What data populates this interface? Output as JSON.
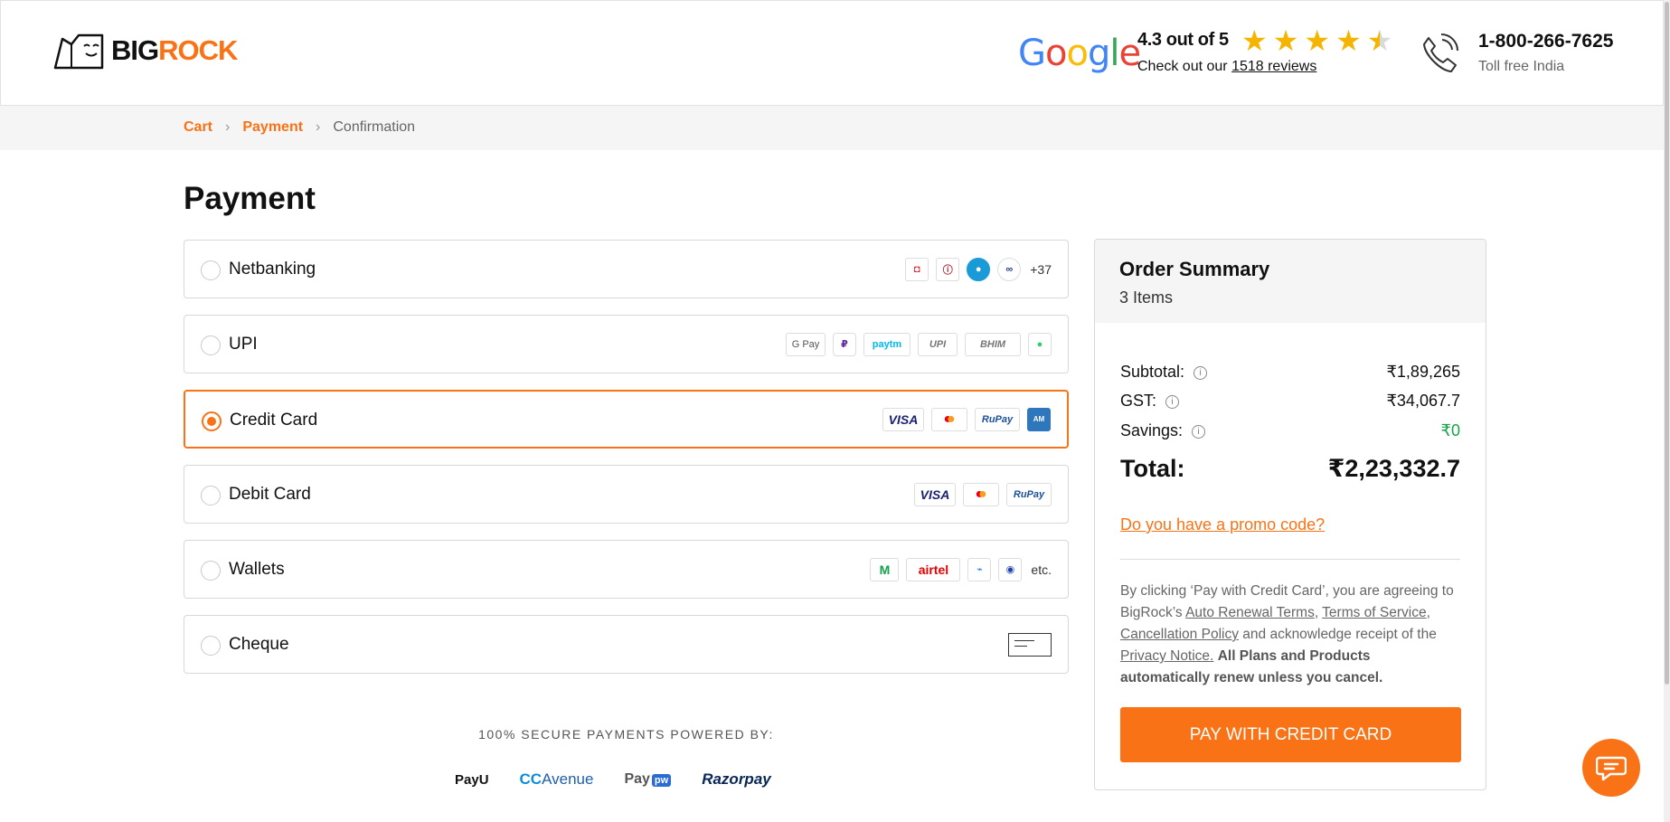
{
  "header": {
    "logo_big": "BIG",
    "logo_rock": "ROCK",
    "google": [
      "G",
      "o",
      "o",
      "g",
      "l",
      "e"
    ],
    "rating_text": "4.3 out of 5",
    "rating_value": 4.3,
    "reviews_prefix": "Check out our ",
    "reviews_link": "1518 reviews",
    "phone": "1-800-266-7625",
    "phone_sub": "Toll free India"
  },
  "breadcrumb": {
    "cart": "Cart",
    "payment": "Payment",
    "confirmation": "Confirmation"
  },
  "page_title": "Payment",
  "options": {
    "netbanking": {
      "label": "Netbanking",
      "more": "+37"
    },
    "upi": {
      "label": "UPI",
      "gpay": "G Pay",
      "paytm": "paytm",
      "upi": "UPI",
      "bhim": "BHIM"
    },
    "credit": {
      "label": "Credit Card",
      "visa": "VISA",
      "rupay": "RuPay"
    },
    "debit": {
      "label": "Debit Card",
      "visa": "VISA",
      "rupay": "RuPay"
    },
    "wallets": {
      "label": "Wallets",
      "airtel": "airtel",
      "etc": "etc."
    },
    "cheque": {
      "label": "Cheque"
    }
  },
  "secure_text": "100% SECURE PAYMENTS POWERED BY:",
  "gateways": {
    "payu": "PayU",
    "cca_cc": "CC",
    "cca_rest": "Avenue",
    "paypw": "Pay",
    "paypw_badge": "pw",
    "razorpay": "Razorpay"
  },
  "summary": {
    "title": "Order Summary",
    "items": "3 Items",
    "subtotal_label": "Subtotal:",
    "subtotal": "₹1,89,265",
    "gst_label": "GST:",
    "gst": "₹34,067.7",
    "savings_label": "Savings:",
    "savings": "₹0",
    "total_label": "Total:",
    "total": "₹2,23,332.7",
    "promo": "Do you have a promo code?",
    "terms_1": "By clicking ‘Pay with Credit Card’, you are agreeing to BigRock’s ",
    "auto_renewal": "Auto Renewal Terms",
    "terms_of_service": "Terms of Service",
    "cancellation": "Cancellation Policy",
    "terms_2": " and acknowledge receipt of the ",
    "privacy": "Privacy Notice.",
    "terms_bold": "All Plans and Products automatically renew unless you cancel.",
    "pay_button": "PAY WITH CREDIT CARD"
  },
  "colors": {
    "accent": "#f97316",
    "savings": "#16a34a"
  }
}
